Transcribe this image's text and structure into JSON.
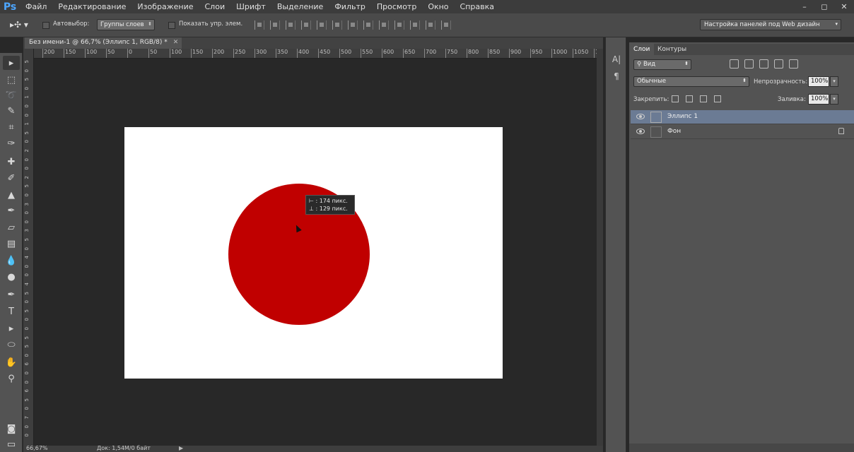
{
  "app": {
    "logo": "Ps"
  },
  "menu": [
    "Файл",
    "Редактирование",
    "Изображение",
    "Слои",
    "Шрифт",
    "Выделение",
    "Фильтр",
    "Просмотр",
    "Окно",
    "Справка"
  ],
  "window_controls": [
    "–",
    "◻",
    "✕"
  ],
  "options": {
    "autoselect_label": "Автовыбор:",
    "autoselect_value": "Группы слоев",
    "show_controls_label": "Показать упр. элем.",
    "workspace": "Настройка панелей под Web дизайн"
  },
  "document": {
    "tab_title": "Без имени-1 @ 66,7% (Эллипс 1, RGB/8) *",
    "tab_close": "✕",
    "ruler_top": [
      "200",
      "150",
      "100",
      "50",
      "0",
      "50",
      "100",
      "150",
      "200",
      "250",
      "300",
      "350",
      "400",
      "450",
      "500",
      "550",
      "600",
      "650",
      "700",
      "750",
      "800",
      "850",
      "900",
      "950",
      "1000",
      "1050",
      "1"
    ],
    "ruler_left": [
      "5",
      "0",
      "5",
      "0",
      "1",
      "0",
      "0",
      "1",
      "5",
      "0",
      "2",
      "0",
      "0",
      "2",
      "5",
      "0",
      "3",
      "0",
      "0",
      "3",
      "5",
      "0",
      "4",
      "0",
      "0",
      "4",
      "5",
      "0",
      "5",
      "0",
      "0",
      "5",
      "5",
      "0",
      "6",
      "0",
      "0",
      "6",
      "5",
      "0",
      "7",
      "0",
      "0"
    ],
    "ellipse_color": "#c00000",
    "canvas_color": "#ffffff",
    "tooltip": {
      "width_label": "174 пикс.",
      "height_label": "129 пикс."
    }
  },
  "status": {
    "zoom": "66,67%",
    "doc_info": "Док: 1,54M/0 байт"
  },
  "layers_panel": {
    "tabs": [
      "Слои",
      "Контуры"
    ],
    "filter": "Вид",
    "blend_mode": "Обычные",
    "opacity_label": "Непрозрачность:",
    "opacity_value": "100%",
    "lock_label": "Закрепить:",
    "fill_label": "Заливка:",
    "fill_value": "100%",
    "layers": [
      {
        "name": "Эллипс 1",
        "selected": true
      },
      {
        "name": "Фон",
        "selected": false,
        "locked": true
      }
    ]
  }
}
